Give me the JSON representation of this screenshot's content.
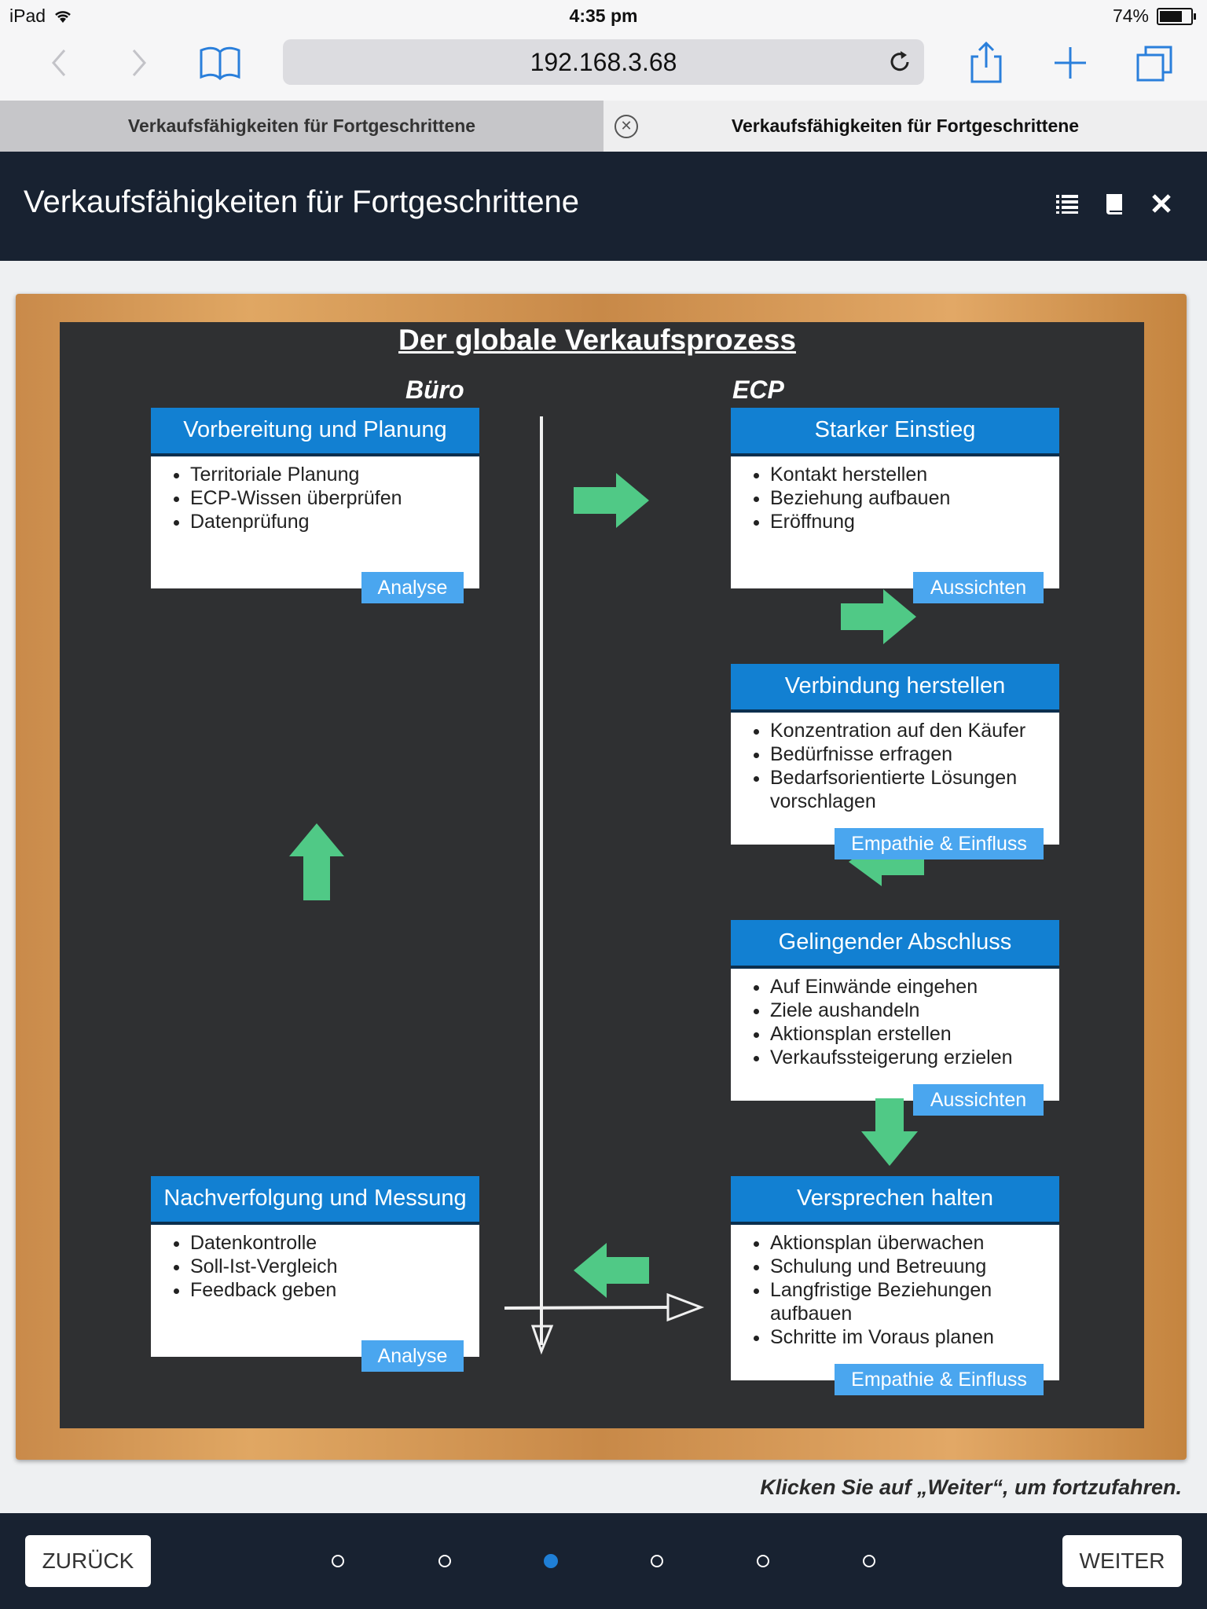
{
  "status_bar": {
    "device": "iPad",
    "time": "4:35 pm",
    "battery": "74%",
    "battery_level": 0.74
  },
  "browser": {
    "url": "192.168.3.68",
    "tabs": [
      {
        "label": "Verkaufsfähigkeiten für Fortgeschrittene",
        "active": false
      },
      {
        "label": "Verkaufsfähigkeiten für Fortgeschrittene",
        "active": true
      }
    ],
    "icons": [
      "back-icon",
      "forward-icon",
      "bookmarks-icon",
      "reload-icon",
      "share-icon",
      "new-tab-icon",
      "tabs-icon",
      "close-tab-icon"
    ]
  },
  "app": {
    "title": "Verkaufsfähigkeiten für Fortgeschrittene",
    "header_icons": [
      "list-icon",
      "book-icon",
      "close-icon"
    ]
  },
  "board": {
    "title": "Der globale Verkaufsprozess",
    "columns": {
      "left": "Büro",
      "right": "ECP"
    },
    "cards": [
      {
        "title": "Vorbereitung und Planung",
        "items": [
          "Territoriale Planung",
          "ECP-Wissen überprüfen",
          "Datenprüfung"
        ],
        "tag": "Analyse"
      },
      {
        "title": "Starker Einstieg",
        "items": [
          "Kontakt herstellen",
          "Beziehung aufbauen",
          "Eröffnung"
        ],
        "tag": "Aussichten"
      },
      {
        "title": "Verbindung herstellen",
        "items": [
          "Konzentration auf den Käufer",
          "Bedürfnisse erfragen",
          "Bedarfsorientierte Lösungen vorschlagen"
        ],
        "tag": "Empathie & Einfluss"
      },
      {
        "title": "Gelingender Abschluss",
        "items": [
          "Auf Einwände eingehen",
          "Ziele aushandeln",
          "Aktionsplan erstellen",
          "Verkaufssteigerung erzielen"
        ],
        "tag": "Aussichten"
      },
      {
        "title": "Versprechen halten",
        "items": [
          "Aktionsplan überwachen",
          "Schulung und Betreuung",
          "Langfristige Beziehungen aufbauen",
          "Schritte im Voraus planen"
        ],
        "tag": "Empathie & Einfluss"
      },
      {
        "title": "Nachverfolgung und Messung",
        "items": [
          "Datenkontrolle",
          "Soll-Ist-Vergleich",
          "Feedback geben"
        ],
        "tag": "Analyse"
      }
    ],
    "accent_colors": {
      "card_header": "#1280d2",
      "tag": "#4aa6ef",
      "arrow": "#50c986",
      "board": "#2f3032"
    }
  },
  "footer": {
    "hint": "Klicken Sie auf „Weiter“, um fortzufahren.",
    "back_label": "ZURÜCK",
    "next_label": "WEITER",
    "page_dots": 6,
    "active_page": 3
  }
}
